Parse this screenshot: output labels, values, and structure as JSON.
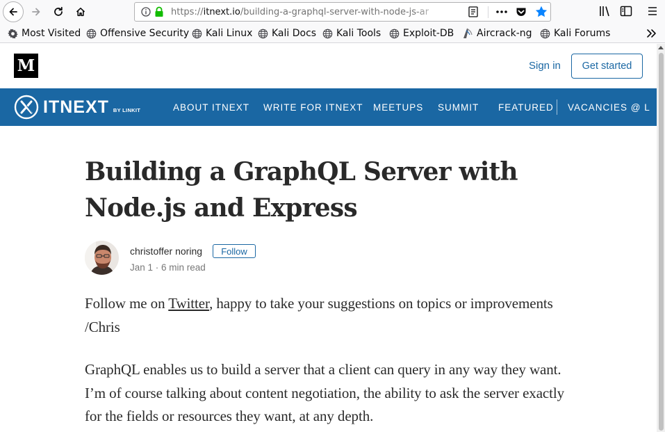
{
  "browser": {
    "url_prefix": "https://",
    "url_host": "itnext.io",
    "url_path": "/building-a-graphql-server-with-node-js-ar"
  },
  "bookmarks": [
    {
      "label": "Most Visited",
      "icon": "gear-icon"
    },
    {
      "label": "Offensive Security",
      "icon": "globe-icon"
    },
    {
      "label": "Kali Linux",
      "icon": "globe-icon"
    },
    {
      "label": "Kali Docs",
      "icon": "globe-icon"
    },
    {
      "label": "Kali Tools",
      "icon": "globe-icon"
    },
    {
      "label": "Exploit-DB",
      "icon": "globe-icon"
    },
    {
      "label": "Aircrack-ng",
      "icon": "aircrack-icon"
    },
    {
      "label": "Kali Forums",
      "icon": "globe-icon"
    }
  ],
  "medium": {
    "logo_letter": "M",
    "sign_in": "Sign in",
    "get_started": "Get started"
  },
  "publication": {
    "name": "ITNEXT",
    "by_line": "BY LINKIT",
    "nav": [
      "ABOUT ITNEXT",
      "WRITE FOR ITNEXT",
      "MEETUPS",
      "SUMMIT",
      "FEATURED",
      "VACANCIES @ L"
    ]
  },
  "article": {
    "title_line1": "Building a GraphQL Server with",
    "title_line2": "Node.js and Express",
    "author": "christoffer noring",
    "follow": "Follow",
    "meta": "Jan 1 · 6 min read",
    "p1_before": "Follow me on ",
    "p1_link": "Twitter",
    "p1_after": ", happy to take your suggestions on topics or improvements /Chris",
    "p2": "GraphQL enables us to build a server that a client can query in any way they want. I’m of course talking about content negotiation, the ability to ask the server exactly for the fields or resources they want, at any depth."
  },
  "colors": {
    "brand_blue": "#1a67a3",
    "text_primary": "#212121",
    "star_blue": "#0a84ff"
  }
}
